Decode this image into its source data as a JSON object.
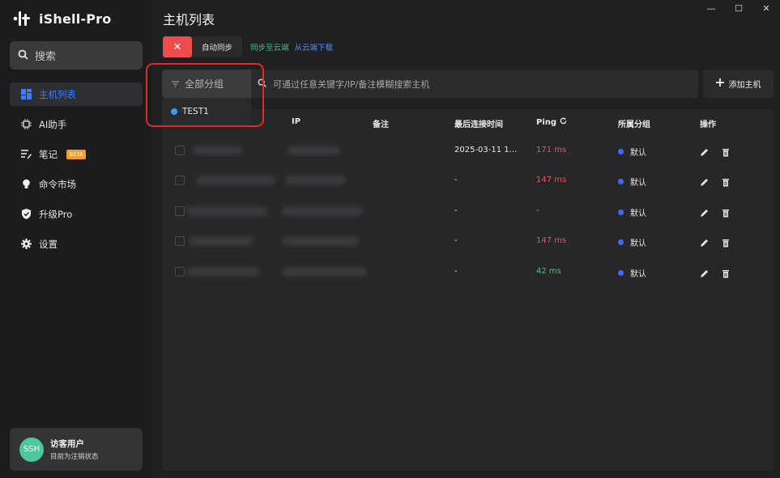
{
  "app": {
    "name": "iShell-Pro"
  },
  "sidebar": {
    "search_label": "搜索",
    "items": [
      {
        "label": "主机列表",
        "icon": "dashboard-icon",
        "active": true
      },
      {
        "label": "AI助手",
        "icon": "ai-chip-icon"
      },
      {
        "label": "笔记",
        "icon": "notes-icon",
        "badge": "BETA"
      },
      {
        "label": "命令市场",
        "icon": "lightbulb-icon"
      },
      {
        "label": "升级Pro",
        "icon": "shield-check-icon"
      },
      {
        "label": "设置",
        "icon": "gear-icon"
      }
    ],
    "user": {
      "avatar_text": "SSH",
      "name": "访客用户",
      "status": "目前为注销状态"
    }
  },
  "main": {
    "title": "主机列表",
    "window_controls": {
      "minimize": "—",
      "maximize": "☐",
      "close": "✕"
    },
    "toolbar": {
      "close_symbol": "✕",
      "auto_sync": "自动同步",
      "sync_to_cloud": "同步至云端",
      "download_from_cloud": "从云端下载"
    },
    "filter": {
      "group_select": "全部分组",
      "search_placeholder": "可通过任意关键字/IP/备注模糊搜索主机",
      "add_button": "添加主机"
    },
    "dropdown": {
      "options": [
        {
          "label": "TEST1",
          "color": "#3a9bff"
        }
      ]
    },
    "table": {
      "headers": {
        "ip": "IP",
        "note": "备注",
        "last_connect": "最后连接时间",
        "ping": "Ping",
        "group": "所属分组",
        "actions": "操作"
      },
      "rows": [
        {
          "last_connect": "2025-03-11 1...",
          "ping": "171 ms",
          "ping_status": "red",
          "group": "默认"
        },
        {
          "last_connect": "-",
          "ping": "147 ms",
          "ping_status": "red",
          "group": "默认"
        },
        {
          "last_connect": "-",
          "ping": "-",
          "ping_status": "none",
          "group": "默认"
        },
        {
          "last_connect": "-",
          "ping": "147 ms",
          "ping_status": "red",
          "group": "默认"
        },
        {
          "last_connect": "-",
          "ping": "42 ms",
          "ping_status": "green",
          "group": "默认"
        }
      ]
    }
  },
  "colors": {
    "accent": "#3d7cff",
    "danger": "#ee4b4b",
    "green": "#3ec28c",
    "group_dot": "#3d6bff",
    "highlight": "#e12a2a"
  }
}
